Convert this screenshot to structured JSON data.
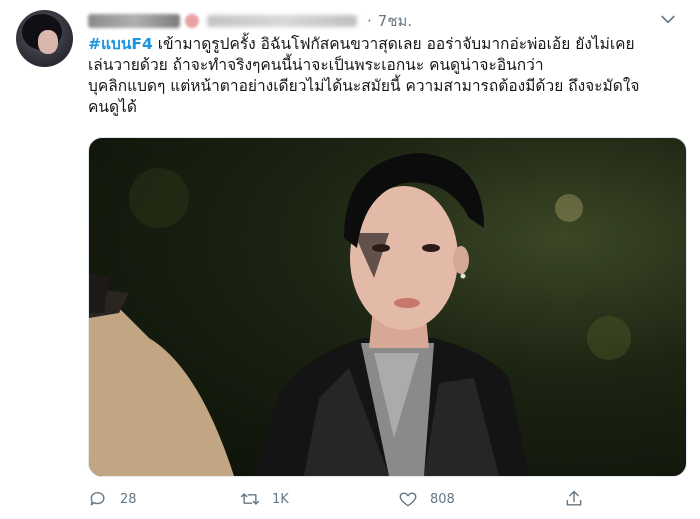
{
  "tweet": {
    "time": "7ชม.",
    "hashtag": "#แบนF4",
    "body": " เข้ามาดูรูปครั้ง อิฉันโฟกัสคนขวาสุดเลย ออร่าจับมากอ่ะพ่อเอ้ย ยังไม่เคย\nเล่นวายด้วย ถ้าจะทำจริงๆคนนี้น่าจะเป็นพระเอกนะ คนดูน่าจะอินกว่า\nบุคลิกแบดๆ แต่หน้าตาอย่างเดียวไม่ได้นะสมัยนี้ ความสามารถต้องมีด้วย ถึงจะมัดใจ\nคนดูได้"
  },
  "actions": {
    "reply_count": "28",
    "retweet_count": "1K",
    "like_count": "808"
  },
  "icons": {
    "more": "chevron-down-icon",
    "reply": "reply-icon",
    "retweet": "retweet-icon",
    "like": "heart-icon",
    "share": "share-icon"
  },
  "colors": {
    "hashtag": "#1b95e0",
    "secondary_text": "#657786"
  }
}
